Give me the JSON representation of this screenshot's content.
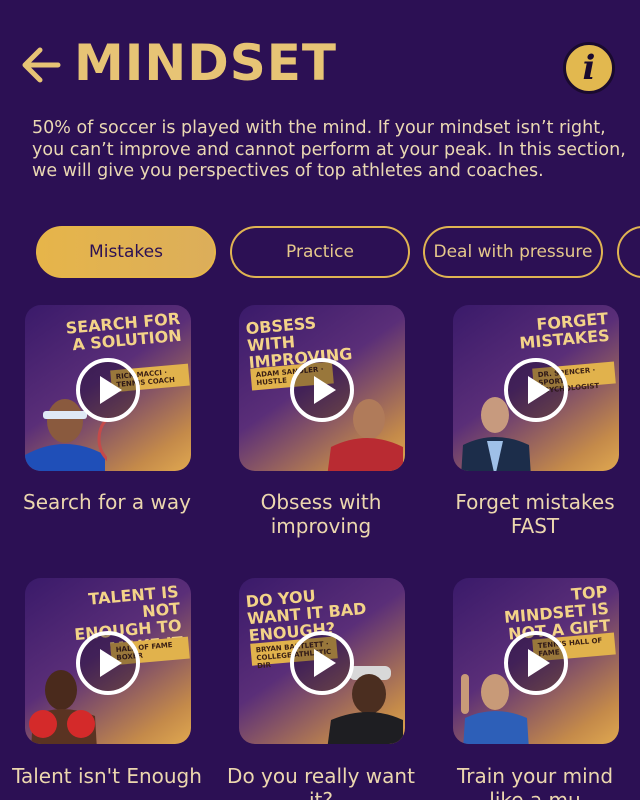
{
  "header": {
    "title": "MINDSET"
  },
  "intro": "50% of soccer is played with the mind. If your mindset isn’t right, you can’t improve and cannot perform at your peak. In this section, we will give you perspectives of top athletes and coaches.",
  "chips": [
    {
      "label": "Mistakes",
      "active": true
    },
    {
      "label": "Practice",
      "active": false
    },
    {
      "label": "Deal with pressure",
      "active": false
    }
  ],
  "cards": [
    {
      "overlay": "SEARCH FOR A SOLUTION",
      "tag": "RICK MACCI · TENNIS COACH",
      "caption": "Search for a way"
    },
    {
      "overlay": "OBSESS WITH IMPROVING",
      "tag": "ADAM SANDLER · HUSTLE",
      "caption": "Obsess with improving"
    },
    {
      "overlay": "FORGET MISTAKES",
      "tag": "DR. SPENCER · SPORT PSYCHOLOGIST",
      "caption": "Forget mistakes FAST"
    },
    {
      "overlay": "TALENT IS NOT ENOUGH TO MAKE IT",
      "tag": "HALL OF FAME BOXER",
      "caption": "Talent isn't Enough"
    },
    {
      "overlay": "DO YOU WANT IT BAD ENOUGH?",
      "tag": "BRYAN BARTLETT · COLLEGE ATHLETIC DIR",
      "caption": "Do you really want it?"
    },
    {
      "overlay": "TOP MINDSET IS NOT A GIFT",
      "tag": "TENNIS HALL OF FAME",
      "caption": "Train your mind like a mu"
    }
  ],
  "colors": {
    "background": "#2c1054",
    "accent": "#e6b54a",
    "text": "#ecd7ae"
  },
  "icons": {
    "back": "arrow-left-icon",
    "info": "info-icon",
    "play": "play-icon"
  }
}
